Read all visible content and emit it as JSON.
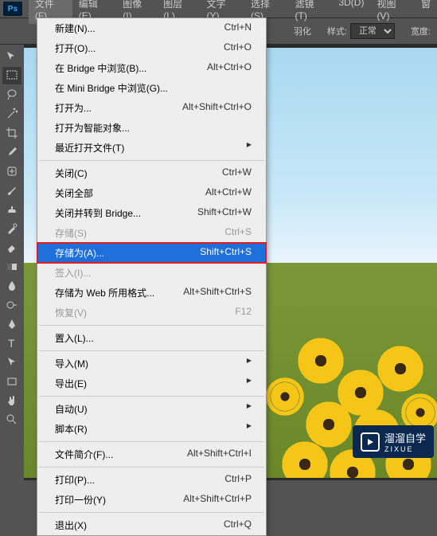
{
  "app": {
    "logo": "Ps"
  },
  "menubar": {
    "items": [
      {
        "label": "文件(F)",
        "active": true
      },
      {
        "label": "编辑(E)"
      },
      {
        "label": "图像(I)"
      },
      {
        "label": "图层(L)"
      },
      {
        "label": "文字(Y)"
      },
      {
        "label": "选择(S)"
      },
      {
        "label": "滤镜(T)"
      },
      {
        "label": "3D(D)"
      },
      {
        "label": "视图(V)"
      },
      {
        "label": "窗"
      }
    ]
  },
  "options": {
    "feather_label": "羽化",
    "style_label": "样式:",
    "style_value": "正常",
    "width_label": "宽度:"
  },
  "dropdown": {
    "groups": [
      [
        {
          "label": "新建(N)...",
          "shortcut": "Ctrl+N"
        },
        {
          "label": "打开(O)...",
          "shortcut": "Ctrl+O"
        },
        {
          "label": "在 Bridge 中浏览(B)...",
          "shortcut": "Alt+Ctrl+O"
        },
        {
          "label": "在 Mini Bridge 中浏览(G)..."
        },
        {
          "label": "打开为...",
          "shortcut": "Alt+Shift+Ctrl+O"
        },
        {
          "label": "打开为智能对象..."
        },
        {
          "label": "最近打开文件(T)",
          "submenu": true
        }
      ],
      [
        {
          "label": "关闭(C)",
          "shortcut": "Ctrl+W"
        },
        {
          "label": "关闭全部",
          "shortcut": "Alt+Ctrl+W"
        },
        {
          "label": "关闭并转到 Bridge...",
          "shortcut": "Shift+Ctrl+W"
        },
        {
          "label": "存储(S)",
          "shortcut": "Ctrl+S",
          "disabled": true
        },
        {
          "label": "存储为(A)...",
          "shortcut": "Shift+Ctrl+S",
          "highlighted": true,
          "boxed": true
        },
        {
          "label": "签入(I)...",
          "disabled": true
        },
        {
          "label": "存储为 Web 所用格式...",
          "shortcut": "Alt+Shift+Ctrl+S"
        },
        {
          "label": "恢复(V)",
          "shortcut": "F12",
          "disabled": true
        }
      ],
      [
        {
          "label": "置入(L)..."
        }
      ],
      [
        {
          "label": "导入(M)",
          "submenu": true
        },
        {
          "label": "导出(E)",
          "submenu": true
        }
      ],
      [
        {
          "label": "自动(U)",
          "submenu": true
        },
        {
          "label": "脚本(R)",
          "submenu": true
        }
      ],
      [
        {
          "label": "文件简介(F)...",
          "shortcut": "Alt+Shift+Ctrl+I"
        }
      ],
      [
        {
          "label": "打印(P)...",
          "shortcut": "Ctrl+P"
        },
        {
          "label": "打印一份(Y)",
          "shortcut": "Alt+Shift+Ctrl+P"
        }
      ],
      [
        {
          "label": "退出(X)",
          "shortcut": "Ctrl+Q"
        }
      ]
    ]
  },
  "watermark": {
    "brand": "溜溜自学",
    "sub": "ZIXUE"
  }
}
